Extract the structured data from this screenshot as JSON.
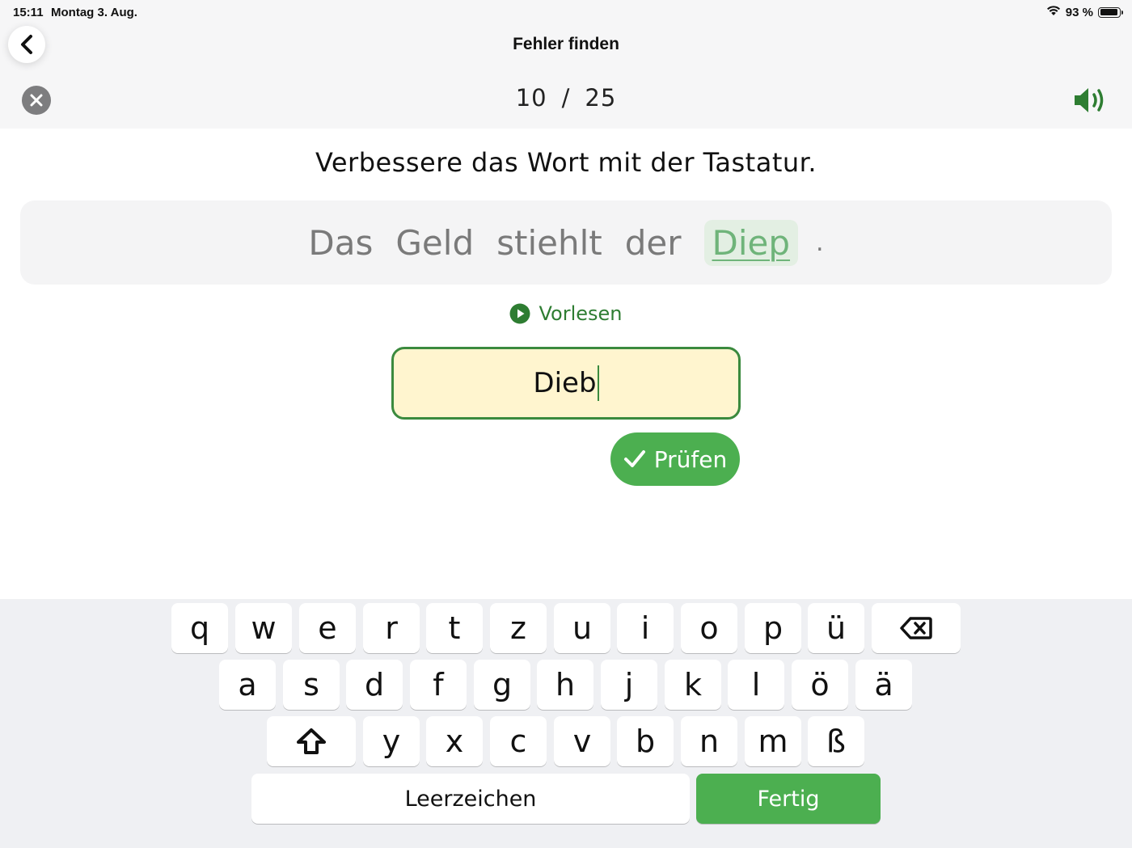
{
  "status_bar": {
    "time": "15:11",
    "date": "Montag 3. Aug.",
    "battery_percent": "93 %",
    "battery_level": 0.93
  },
  "nav": {
    "title": "Fehler finden",
    "back_icon": "chevron-left-icon",
    "close_icon": "close-icon",
    "speaker_icon": "speaker-icon"
  },
  "progress": {
    "current": "10",
    "separator": "/",
    "total": "25"
  },
  "instruction": "Verbessere das Wort mit der Tastatur.",
  "sentence": {
    "words": [
      "Das",
      "Geld",
      "stiehlt",
      "der"
    ],
    "wrong_word": "Diep",
    "punctuation": "."
  },
  "read_aloud": {
    "label": "Vorlesen",
    "icon": "play-icon"
  },
  "answer_input": {
    "value": "Dieb"
  },
  "check_button": {
    "label": "Prüfen",
    "icon": "checkmark-icon"
  },
  "keyboard": {
    "row1": [
      "q",
      "w",
      "e",
      "r",
      "t",
      "z",
      "u",
      "i",
      "o",
      "p",
      "ü"
    ],
    "row2": [
      "a",
      "s",
      "d",
      "f",
      "g",
      "h",
      "j",
      "k",
      "l",
      "ö",
      "ä"
    ],
    "row3": [
      "y",
      "x",
      "c",
      "v",
      "b",
      "n",
      "m",
      "ß"
    ],
    "backspace_icon": "backspace-icon",
    "shift_icon": "shift-icon",
    "space_label": "Leerzeichen",
    "done_label": "Fertig"
  },
  "colors": {
    "accent_green": "#4caf50",
    "dark_green": "#2e7d32",
    "input_background": "#fff5cf",
    "wrong_word": "#6fb47a",
    "panel": "#f4f4f5",
    "keyboard_background": "#eff0f3"
  }
}
